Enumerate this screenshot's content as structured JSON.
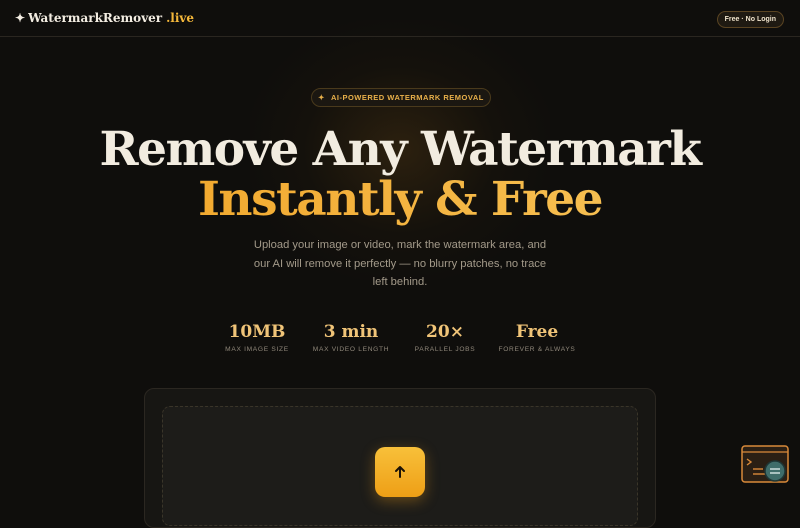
{
  "header": {
    "logo_star": "✦",
    "logo_name": "WatermarkRemover",
    "logo_tld": ".live",
    "badge": "Free · No Login"
  },
  "hero": {
    "tag_icon": "✦",
    "tag": "AI-POWERED WATERMARK REMOVAL",
    "title_line1": "Remove Any Watermark",
    "title_line2": "Instantly & Free",
    "lead": "Upload your image or video, mark the watermark area, and our AI will remove it perfectly — no blurry patches, no trace left behind."
  },
  "stats": [
    {
      "value": "10MB",
      "label": "MAX IMAGE SIZE"
    },
    {
      "value": "3 min",
      "label": "MAX VIDEO LENGTH"
    },
    {
      "value": "20×",
      "label": "PARALLEL JOBS"
    },
    {
      "value": "Free",
      "label": "FOREVER & ALWAYS"
    }
  ],
  "upload": {
    "icon": "arrow-up-icon"
  },
  "colors": {
    "accent": "#f5b02c",
    "background": "#0f0e0c"
  }
}
